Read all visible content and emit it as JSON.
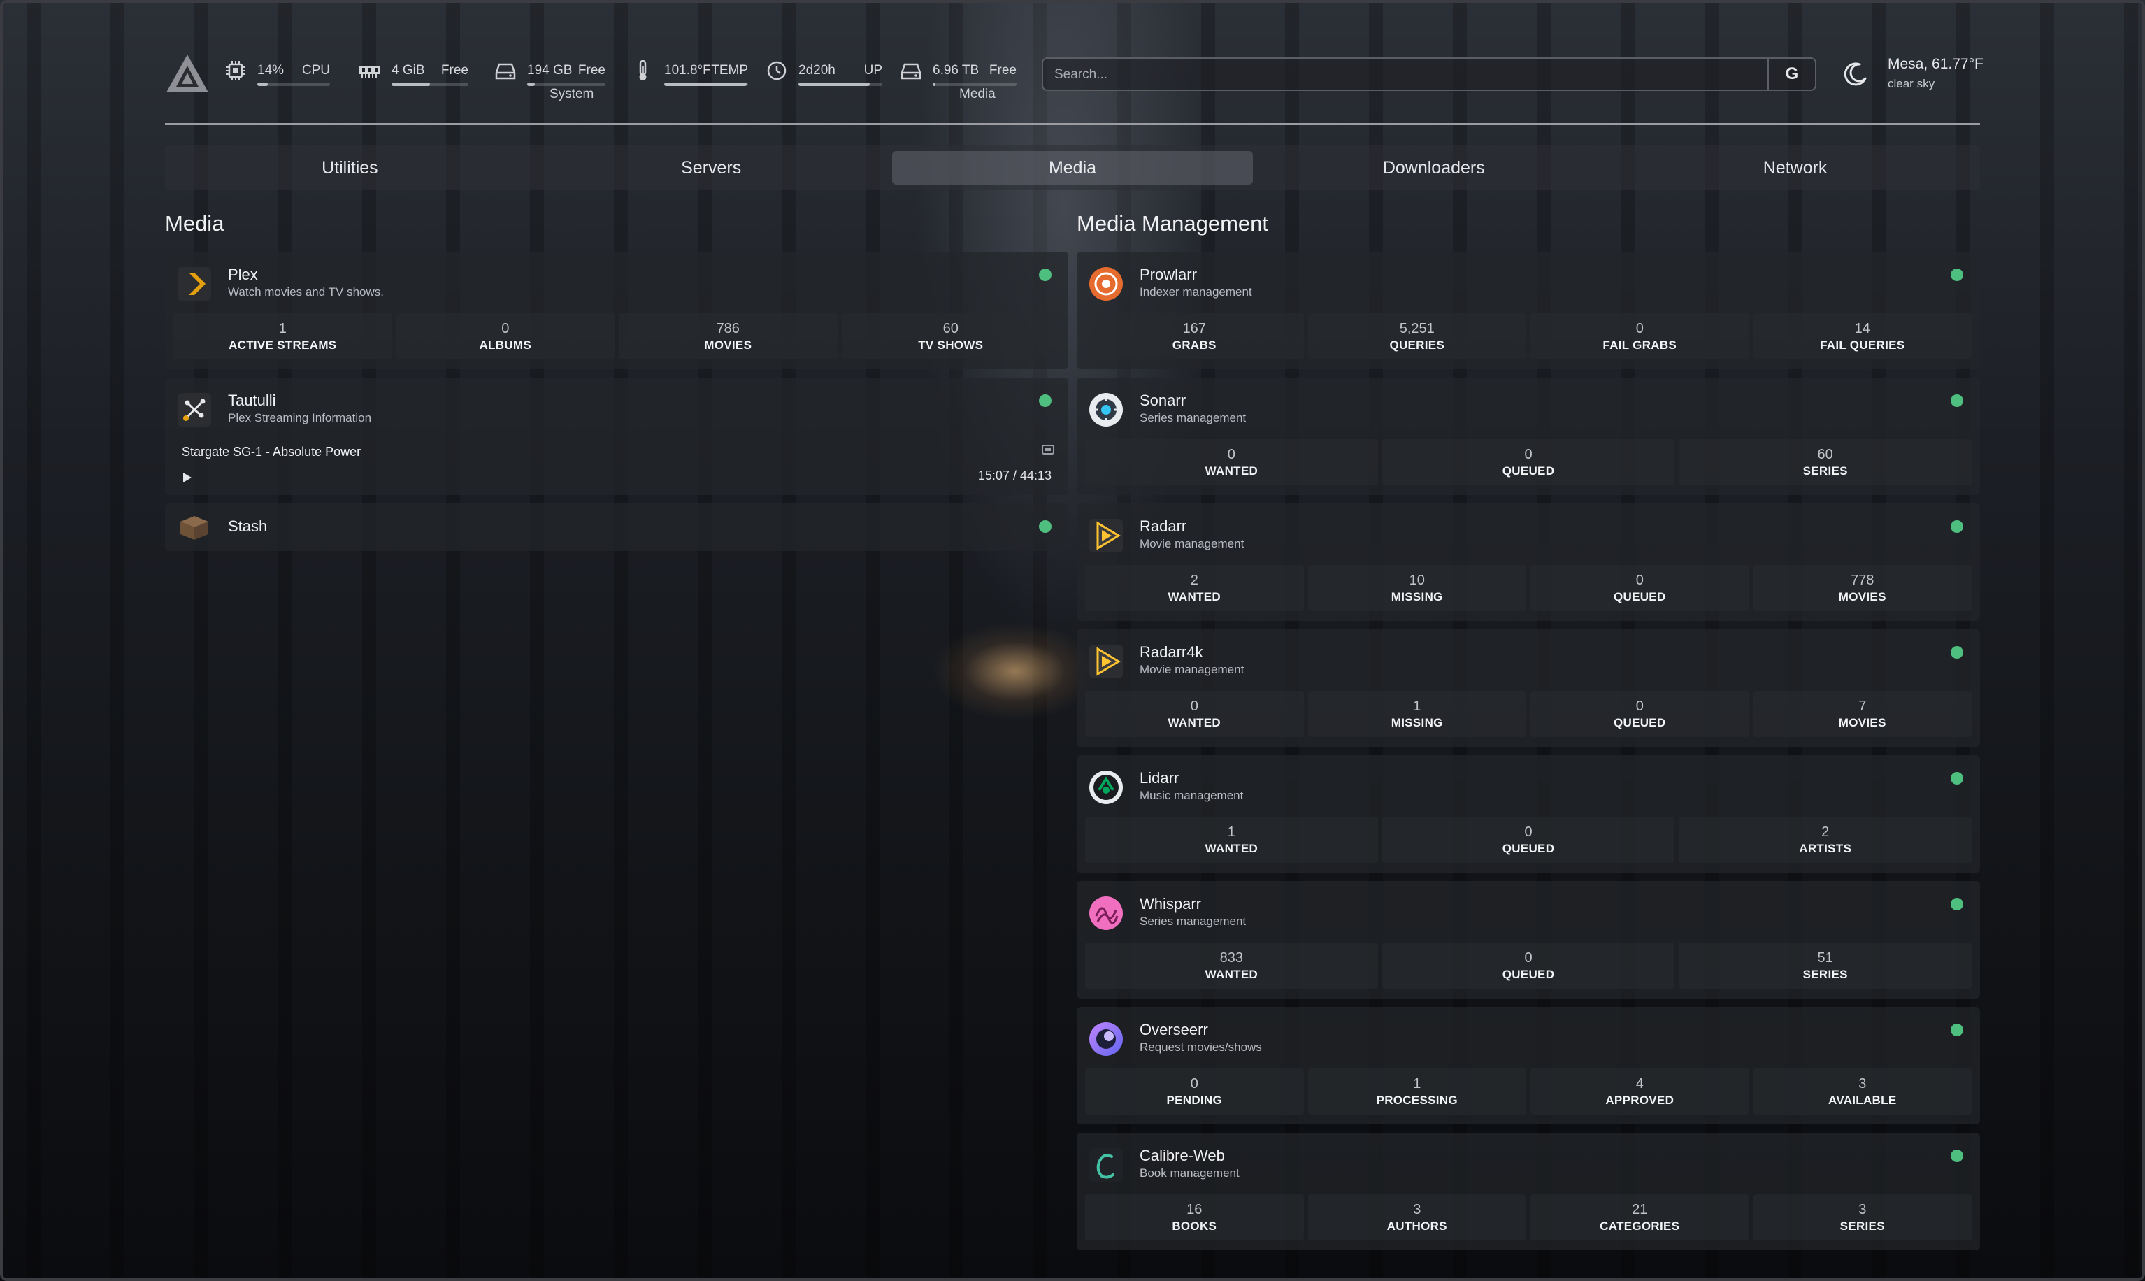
{
  "header": {
    "resources": [
      {
        "icon": "cpu-icon",
        "value": "14%",
        "label": "CPU",
        "fill": 0.14
      },
      {
        "icon": "memory-icon",
        "value": "4 GiB",
        "label": "Free",
        "fill": 0.5
      },
      {
        "icon": "disk-icon",
        "value": "194 GB",
        "label": "Free",
        "fill": 0.1
      },
      {
        "icon": "thermometer-icon",
        "value": "101.8°F",
        "label": "TEMP",
        "fill": 0.98
      },
      {
        "icon": "clock-icon",
        "value": "2d20h",
        "label": "UP",
        "fill": 0.85
      },
      {
        "icon": "disk-icon",
        "value": "6.96 TB",
        "label": "Free",
        "fill": 0.03
      }
    ],
    "groups": {
      "system": "System",
      "media": "Media"
    },
    "search": {
      "placeholder": "Search...",
      "engine": "G"
    },
    "weather": {
      "location": "Mesa, 61.77°F",
      "condition": "clear sky"
    }
  },
  "tabs": [
    {
      "label": "Utilities"
    },
    {
      "label": "Servers"
    },
    {
      "label": "Media",
      "active": true
    },
    {
      "label": "Downloaders"
    },
    {
      "label": "Network"
    }
  ],
  "media": {
    "title": "Media",
    "plex": {
      "name": "Plex",
      "desc": "Watch movies and TV shows.",
      "stats": [
        {
          "value": "1",
          "label": "ACTIVE STREAMS"
        },
        {
          "value": "0",
          "label": "ALBUMS"
        },
        {
          "value": "786",
          "label": "MOVIES"
        },
        {
          "value": "60",
          "label": "TV SHOWS"
        }
      ]
    },
    "tautulli": {
      "name": "Tautulli",
      "desc": "Plex Streaming Information",
      "now_playing": "Stargate SG-1 - Absolute Power",
      "time": "15:07 / 44:13"
    },
    "stash": {
      "name": "Stash"
    }
  },
  "management": {
    "title": "Media Management",
    "services": [
      {
        "name": "Prowlarr",
        "desc": "Indexer management",
        "icon": "prowlarr-icon",
        "stats": [
          {
            "value": "167",
            "label": "GRABS"
          },
          {
            "value": "5,251",
            "label": "QUERIES"
          },
          {
            "value": "0",
            "label": "FAIL GRABS"
          },
          {
            "value": "14",
            "label": "FAIL QUERIES"
          }
        ]
      },
      {
        "name": "Sonarr",
        "desc": "Series management",
        "icon": "sonarr-icon",
        "stats": [
          {
            "value": "0",
            "label": "WANTED"
          },
          {
            "value": "0",
            "label": "QUEUED"
          },
          {
            "value": "60",
            "label": "SERIES"
          }
        ]
      },
      {
        "name": "Radarr",
        "desc": "Movie management",
        "icon": "radarr-icon",
        "stats": [
          {
            "value": "2",
            "label": "WANTED"
          },
          {
            "value": "10",
            "label": "MISSING"
          },
          {
            "value": "0",
            "label": "QUEUED"
          },
          {
            "value": "778",
            "label": "MOVIES"
          }
        ]
      },
      {
        "name": "Radarr4k",
        "desc": "Movie management",
        "icon": "radarr-icon",
        "stats": [
          {
            "value": "0",
            "label": "WANTED"
          },
          {
            "value": "1",
            "label": "MISSING"
          },
          {
            "value": "0",
            "label": "QUEUED"
          },
          {
            "value": "7",
            "label": "MOVIES"
          }
        ]
      },
      {
        "name": "Lidarr",
        "desc": "Music management",
        "icon": "lidarr-icon",
        "stats": [
          {
            "value": "1",
            "label": "WANTED"
          },
          {
            "value": "0",
            "label": "QUEUED"
          },
          {
            "value": "2",
            "label": "ARTISTS"
          }
        ]
      },
      {
        "name": "Whisparr",
        "desc": "Series management",
        "icon": "whisparr-icon",
        "stats": [
          {
            "value": "833",
            "label": "WANTED"
          },
          {
            "value": "0",
            "label": "QUEUED"
          },
          {
            "value": "51",
            "label": "SERIES"
          }
        ]
      },
      {
        "name": "Overseerr",
        "desc": "Request movies/shows",
        "icon": "overseerr-icon",
        "stats": [
          {
            "value": "0",
            "label": "PENDING"
          },
          {
            "value": "1",
            "label": "PROCESSING"
          },
          {
            "value": "4",
            "label": "APPROVED"
          },
          {
            "value": "3",
            "label": "AVAILABLE"
          }
        ]
      },
      {
        "name": "Calibre-Web",
        "desc": "Book management",
        "icon": "calibre-icon",
        "stats": [
          {
            "value": "16",
            "label": "BOOKS"
          },
          {
            "value": "3",
            "label": "AUTHORS"
          },
          {
            "value": "21",
            "label": "CATEGORIES"
          },
          {
            "value": "3",
            "label": "SERIES"
          }
        ]
      }
    ]
  },
  "colors": {
    "status_ok": "#4fbf80",
    "accent": "#e5a00d"
  }
}
